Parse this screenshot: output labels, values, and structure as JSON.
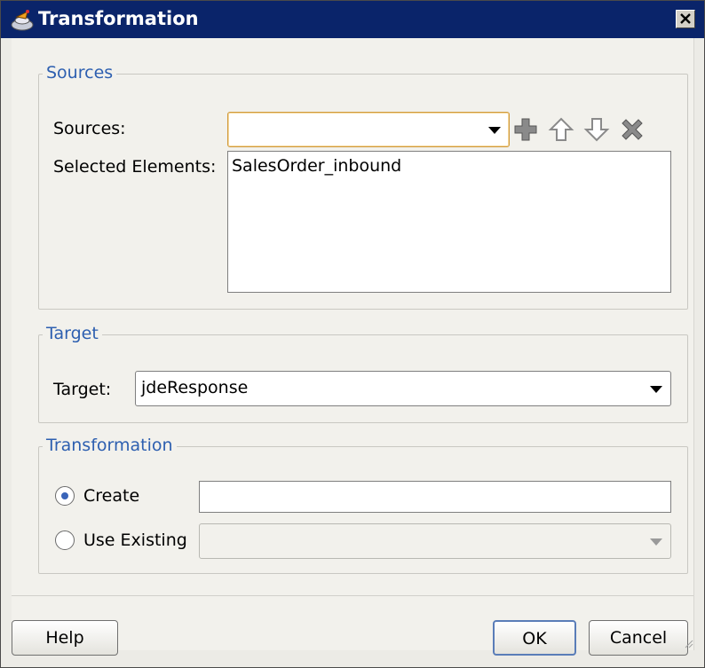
{
  "window": {
    "title": "Transformation"
  },
  "sources_group": {
    "legend": "Sources",
    "sources_label": "Sources:",
    "sources_value": "",
    "selected_label": "Selected Elements:",
    "selected_items": [
      "SalesOrder_inbound"
    ],
    "toolbar_icons": [
      "add-icon",
      "up-arrow-icon",
      "down-arrow-icon",
      "delete-icon"
    ]
  },
  "target_group": {
    "legend": "Target",
    "target_label": "Target:",
    "target_value": "jdeResponse"
  },
  "transformation_group": {
    "legend": "Transformation",
    "create_label": "Create",
    "create_value": "",
    "use_existing_label": "Use Existing",
    "use_existing_value": "",
    "selected_option": "create"
  },
  "buttons": {
    "help": "Help",
    "ok": "OK",
    "cancel": "Cancel"
  }
}
